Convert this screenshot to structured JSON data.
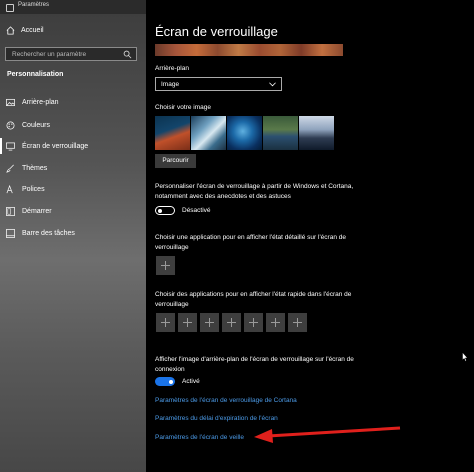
{
  "app": {
    "title": "Paramètres"
  },
  "sidebar": {
    "home_label": "Accueil",
    "search_placeholder": "Rechercher un paramètre",
    "section": "Personnalisation",
    "items": [
      {
        "label": "Arrière-plan",
        "icon": "picture-icon"
      },
      {
        "label": "Couleurs",
        "icon": "palette-icon"
      },
      {
        "label": "Écran de verrouillage",
        "icon": "monitor-icon",
        "active": true
      },
      {
        "label": "Thèmes",
        "icon": "brush-icon"
      },
      {
        "label": "Polices",
        "icon": "font-icon"
      },
      {
        "label": "Démarrer",
        "icon": "start-icon"
      },
      {
        "label": "Barre des tâches",
        "icon": "taskbar-icon"
      }
    ]
  },
  "main": {
    "title": "Écran de verrouillage",
    "background_label": "Arrière-plan",
    "background_value": "Image",
    "choose_image_label": "Choisir votre image",
    "browse_label": "Parcourir",
    "fun_facts_text": "Personnaliser l'écran de verrouillage à partir de Windows et Cortana, notamment avec des anecdotes et des astuces",
    "fun_facts_state": "Désactivé",
    "detailed_app_text": "Choisir une application pour en afficher l'état détaillé sur l'écran de verrouillage",
    "quick_apps_text": "Choisir des applications pour en afficher l'état rapide dans l'écran de verrouillage",
    "signin_bg_text": "Afficher l'image d'arrière-plan de l'écran de verrouillage sur l'écran de connexion",
    "signin_bg_state": "Activé",
    "links": [
      "Paramètres de l'écran de verrouillage de Cortana",
      "Paramètres du délai d'expiration de l'écran",
      "Paramètres de l'écran de veille"
    ]
  },
  "colors": {
    "accent": "#1a73e8",
    "link": "#4c9be8",
    "arrow": "#e0201c"
  }
}
